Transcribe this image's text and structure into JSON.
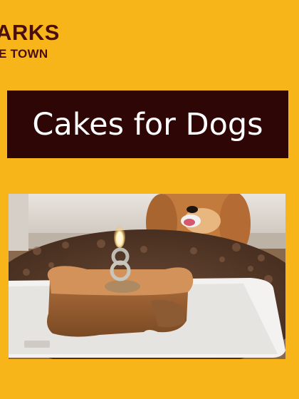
{
  "brand": {
    "line1": "ARKS",
    "line2": "E TOWN",
    "text_color": "#4A0E0E"
  },
  "banner": {
    "title": "Cakes for Dogs",
    "background": "#2E0606",
    "text_color": "#FFFFFF"
  },
  "page": {
    "background": "#F8B51A"
  },
  "photo": {
    "subject": "dog-birthday-cake-photo",
    "candle_number": "8"
  }
}
